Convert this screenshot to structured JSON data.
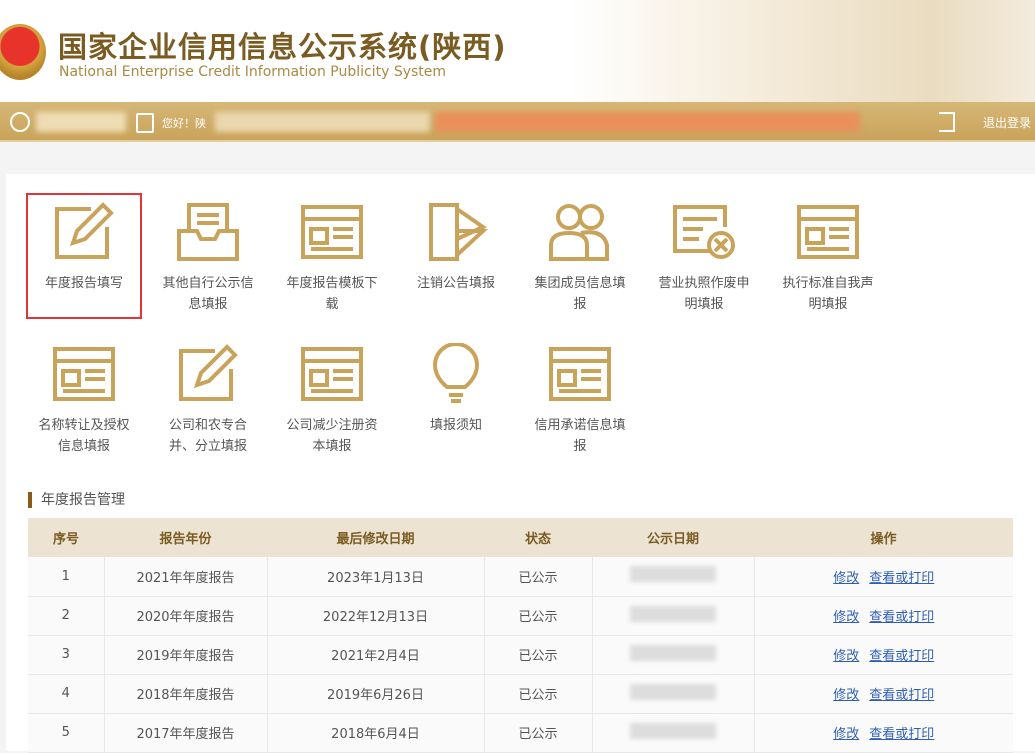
{
  "header": {
    "title": "国家企业信用信息公示系统(陕西)",
    "subtitle": "National Enterprise Credit Information Publicity System"
  },
  "bar": {
    "greeting": "您好！陕",
    "logout": "退出登录"
  },
  "tiles": [
    {
      "label": "年度报告填写",
      "icon": "edit-icon"
    },
    {
      "label": "其他自行公示信息填报",
      "icon": "inbox-icon"
    },
    {
      "label": "年度报告模板下载",
      "icon": "form-icon"
    },
    {
      "label": "注销公告填报",
      "icon": "document-icon"
    },
    {
      "label": "集团成员信息填报",
      "icon": "group-icon"
    },
    {
      "label": "营业执照作废申明填报",
      "icon": "license-void-icon"
    },
    {
      "label": "执行标准自我声明填报",
      "icon": "form-icon"
    },
    {
      "label": "名称转让及授权信息填报",
      "icon": "form-icon"
    },
    {
      "label": "公司和农专合并、分立填报",
      "icon": "edit-icon"
    },
    {
      "label": "公司减少注册资本填报",
      "icon": "form-icon"
    },
    {
      "label": "填报须知",
      "icon": "lightbulb-icon"
    },
    {
      "label": "信用承诺信息填报",
      "icon": "form-icon"
    }
  ],
  "section_title": "年度报告管理",
  "table": {
    "headers": [
      "序号",
      "报告年份",
      "最后修改日期",
      "状态",
      "公示日期",
      "操作"
    ],
    "rows": [
      {
        "no": "1",
        "year": "2021年年度报告",
        "modified": "2023年1月13日",
        "status": "已公示"
      },
      {
        "no": "2",
        "year": "2020年年度报告",
        "modified": "2022年12月13日",
        "status": "已公示"
      },
      {
        "no": "3",
        "year": "2019年年度报告",
        "modified": "2021年2月4日",
        "status": "已公示"
      },
      {
        "no": "4",
        "year": "2018年年度报告",
        "modified": "2019年6月26日",
        "status": "已公示"
      },
      {
        "no": "5",
        "year": "2017年年度报告",
        "modified": "2018年6月4日",
        "status": "已公示"
      }
    ],
    "action_edit": "修改",
    "action_view": "查看或打印"
  },
  "colors": {
    "gold": "#c9a35a",
    "brown": "#7a5c22",
    "link": "#2f5fb3",
    "highlight": "#e0343a"
  }
}
